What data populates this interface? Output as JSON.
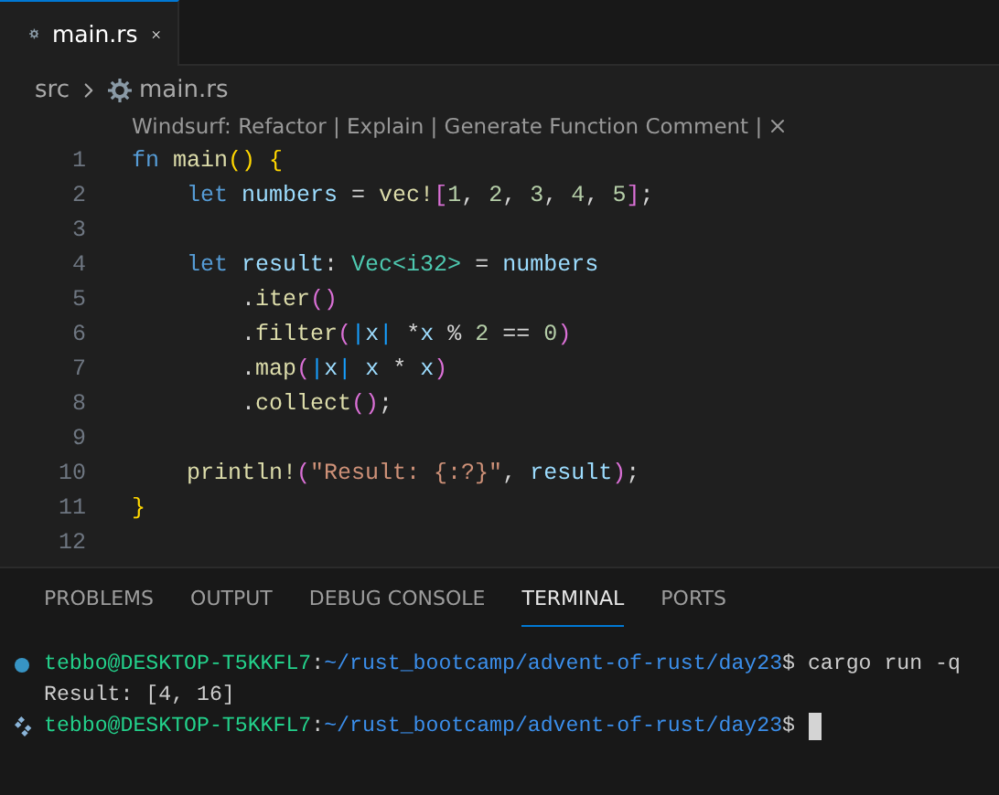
{
  "tabs": [
    {
      "label": "main.rs",
      "selected": true
    }
  ],
  "breadcrumb": [
    "src",
    "main.rs"
  ],
  "codelens": "Windsurf: Refactor | Explain | Generate Function Comment |",
  "code_lines": [
    {
      "number": "1",
      "tokens": [
        {
          "t": "fn ",
          "kind": "keyword"
        },
        {
          "t": "main",
          "kind": "function"
        },
        {
          "t": "()",
          "kind": "bracket1"
        },
        {
          "t": " {",
          "kind": "bracket1"
        }
      ]
    },
    {
      "number": "2",
      "tokens": [
        {
          "t": "    let ",
          "kind": "keyword"
        },
        {
          "t": "numbers",
          "kind": "variable"
        },
        {
          "t": " = ",
          "kind": "plain"
        },
        {
          "t": "vec!",
          "kind": "function"
        },
        {
          "t": "[",
          "kind": "bracket2"
        },
        {
          "t": "1",
          "kind": "number"
        },
        {
          "t": ", ",
          "kind": "plain"
        },
        {
          "t": "2",
          "kind": "number"
        },
        {
          "t": ", ",
          "kind": "plain"
        },
        {
          "t": "3",
          "kind": "number"
        },
        {
          "t": ", ",
          "kind": "plain"
        },
        {
          "t": "4",
          "kind": "number"
        },
        {
          "t": ", ",
          "kind": "plain"
        },
        {
          "t": "5",
          "kind": "number"
        },
        {
          "t": "]",
          "kind": "bracket2"
        },
        {
          "t": ";",
          "kind": "plain"
        }
      ]
    },
    {
      "number": "3"
    },
    {
      "number": "4",
      "tokens": [
        {
          "t": "    let ",
          "kind": "keyword"
        },
        {
          "t": "result",
          "kind": "variable"
        },
        {
          "t": ": ",
          "kind": "plain"
        },
        {
          "t": "Vec<i32>",
          "kind": "type"
        },
        {
          "t": " = ",
          "kind": "plain"
        },
        {
          "t": "numbers",
          "kind": "variable"
        }
      ]
    },
    {
      "number": "5",
      "tokens": [
        {
          "t": "        .",
          "kind": "plain"
        },
        {
          "t": "iter",
          "kind": "function"
        },
        {
          "t": "()",
          "kind": "bracket2"
        }
      ]
    },
    {
      "number": "6",
      "tokens": [
        {
          "t": "        .",
          "kind": "plain"
        },
        {
          "t": "filter",
          "kind": "function"
        },
        {
          "t": "(",
          "kind": "bracket2"
        },
        {
          "t": "|",
          "kind": "bracket3"
        },
        {
          "t": "x",
          "kind": "variable"
        },
        {
          "t": "|",
          "kind": "bracket3"
        },
        {
          "t": " *",
          "kind": "plain"
        },
        {
          "t": "x",
          "kind": "variable"
        },
        {
          "t": " % ",
          "kind": "plain"
        },
        {
          "t": "2",
          "kind": "number"
        },
        {
          "t": " == ",
          "kind": "plain"
        },
        {
          "t": "0",
          "kind": "number"
        },
        {
          "t": ")",
          "kind": "bracket2"
        }
      ]
    },
    {
      "number": "7",
      "tokens": [
        {
          "t": "        .",
          "kind": "plain"
        },
        {
          "t": "map",
          "kind": "function"
        },
        {
          "t": "(",
          "kind": "bracket2"
        },
        {
          "t": "|",
          "kind": "bracket3"
        },
        {
          "t": "x",
          "kind": "variable"
        },
        {
          "t": "|",
          "kind": "bracket3"
        },
        {
          "t": " x",
          "kind": "variable"
        },
        {
          "t": " * ",
          "kind": "plain"
        },
        {
          "t": "x",
          "kind": "variable"
        },
        {
          "t": ")",
          "kind": "bracket2"
        }
      ]
    },
    {
      "number": "8",
      "tokens": [
        {
          "t": "        .",
          "kind": "plain"
        },
        {
          "t": "collect",
          "kind": "function"
        },
        {
          "t": "()",
          "kind": "bracket2"
        },
        {
          "t": ";",
          "kind": "plain"
        }
      ]
    },
    {
      "number": "9"
    },
    {
      "number": "10",
      "tokens": [
        {
          "t": "    println!",
          "kind": "function"
        },
        {
          "t": "(",
          "kind": "bracket2"
        },
        {
          "t": "\"Result: {:?}\"",
          "kind": "string"
        },
        {
          "t": ", ",
          "kind": "plain"
        },
        {
          "t": "result",
          "kind": "variable"
        },
        {
          "t": ")",
          "kind": "bracket2"
        },
        {
          "t": ";",
          "kind": "plain"
        }
      ]
    },
    {
      "number": "11",
      "tokens": [
        {
          "t": "}",
          "kind": "bracket1"
        }
      ]
    },
    {
      "number": "12"
    }
  ],
  "panel_tabs": [
    {
      "label": "PROBLEMS",
      "selected": false
    },
    {
      "label": "OUTPUT",
      "selected": false
    },
    {
      "label": "DEBUG CONSOLE",
      "selected": false
    },
    {
      "label": "TERMINAL",
      "selected": true
    },
    {
      "label": "PORTS",
      "selected": false
    }
  ],
  "terminal": [
    {
      "kind": "prompt",
      "succeeded": true,
      "user": "tebbo@DESKTOP-T5KKFL7",
      "sep": ":",
      "path": "~/rust_bootcamp/advent-of-rust/day23",
      "symbol": "$",
      "command": " cargo run -q"
    },
    {
      "kind": "output",
      "text": "Result: [4, 16]"
    },
    {
      "kind": "prompt",
      "succeeded": false,
      "user": "tebbo@DESKTOP-T5KKFL7",
      "sep": ":",
      "path": "~/rust_bootcamp/advent-of-rust/day23",
      "symbol": "$",
      "cursor": true
    }
  ]
}
